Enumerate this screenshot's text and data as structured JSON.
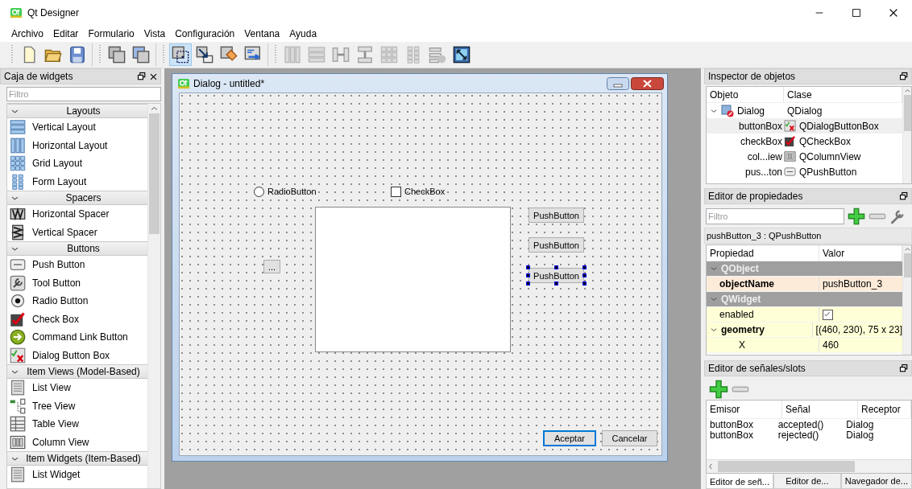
{
  "window": {
    "title": "Qt Designer"
  },
  "menu": [
    {
      "label": "Archivo"
    },
    {
      "label": "Editar"
    },
    {
      "label": "Formulario"
    },
    {
      "label": "Vista"
    },
    {
      "label": "Configuración"
    },
    {
      "label": "Ventana"
    },
    {
      "label": "Ayuda"
    }
  ],
  "toolbar": [
    [
      {
        "kind": "new",
        "selected": false,
        "disabled": false
      },
      {
        "kind": "open",
        "selected": false,
        "disabled": false
      },
      {
        "kind": "save",
        "selected": false,
        "disabled": false
      }
    ],
    [
      {
        "kind": "window_back",
        "selected": false,
        "disabled": false
      },
      {
        "kind": "window_front",
        "selected": false,
        "disabled": false
      }
    ],
    [
      {
        "kind": "edit_widgets",
        "selected": true,
        "disabled": false
      },
      {
        "kind": "signals",
        "selected": false,
        "disabled": false
      },
      {
        "kind": "buddies",
        "selected": false,
        "disabled": false
      },
      {
        "kind": "tab_order",
        "selected": false,
        "disabled": false
      }
    ],
    [
      {
        "kind": "hlayout",
        "selected": false,
        "disabled": true
      },
      {
        "kind": "vlayout",
        "selected": false,
        "disabled": true
      },
      {
        "kind": "hsplit",
        "selected": false,
        "disabled": true
      },
      {
        "kind": "vsplit",
        "selected": false,
        "disabled": true
      },
      {
        "kind": "grid",
        "selected": false,
        "disabled": true
      },
      {
        "kind": "form",
        "selected": false,
        "disabled": true
      },
      {
        "kind": "break_layout",
        "selected": false,
        "disabled": true
      },
      {
        "kind": "adjust_size",
        "selected": false,
        "disabled": false
      }
    ]
  ],
  "widget_box": {
    "title": "Caja de widgets",
    "filter": {
      "placeholder": "Filtro"
    },
    "categories": [
      {
        "label": "Layouts",
        "expanded": true,
        "items": [
          {
            "label": "Vertical Layout",
            "kind": "vlayout"
          },
          {
            "label": "Horizontal Layout",
            "kind": "hlayout"
          },
          {
            "label": "Grid Layout",
            "kind": "grid"
          },
          {
            "label": "Form Layout",
            "kind": "form"
          }
        ]
      },
      {
        "label": "Spacers",
        "expanded": true,
        "items": [
          {
            "label": "Horizontal Spacer",
            "kind": "hspacer"
          },
          {
            "label": "Vertical Spacer",
            "kind": "vspacer"
          }
        ]
      },
      {
        "label": "Buttons",
        "expanded": true,
        "items": [
          {
            "label": "Push Button",
            "kind": "pushbutton"
          },
          {
            "label": "Tool Button",
            "kind": "toolbutton"
          },
          {
            "label": "Radio Button",
            "kind": "radio"
          },
          {
            "label": "Check Box",
            "kind": "checkbox"
          },
          {
            "label": "Command Link Button",
            "kind": "commandlink"
          },
          {
            "label": "Dialog Button Box",
            "kind": "dialogbuttonbox"
          }
        ]
      },
      {
        "label": "Item Views (Model-Based)",
        "expanded": true,
        "items": [
          {
            "label": "List View",
            "kind": "listview"
          },
          {
            "label": "Tree View",
            "kind": "treeview"
          },
          {
            "label": "Table View",
            "kind": "tableview"
          },
          {
            "label": "Column View",
            "kind": "columnview"
          }
        ]
      },
      {
        "label": "Item Widgets (Item-Based)",
        "expanded": true,
        "items": [
          {
            "label": "List Widget",
            "kind": "listview"
          }
        ]
      }
    ]
  },
  "form": {
    "title": "Dialog - untitled*",
    "widgets": [
      {
        "kind": "radio",
        "label": "RadioButton",
        "checked": false,
        "selected": false
      },
      {
        "kind": "checkbox",
        "label": "CheckBox",
        "checked": false,
        "selected": false
      },
      {
        "kind": "columnview",
        "selected": false
      },
      {
        "kind": "pushbutton",
        "label": "PushButton",
        "selected": false
      },
      {
        "kind": "pushbutton",
        "label": "PushButton",
        "selected": false
      },
      {
        "kind": "pushbutton",
        "label": "PushButton",
        "selected": true
      },
      {
        "kind": "toolbutton",
        "label": "...",
        "selected": false
      },
      {
        "kind": "dialogbutton",
        "label": "Aceptar",
        "default": true,
        "selected": false
      },
      {
        "kind": "dialogbutton",
        "label": "Cancelar",
        "default": false,
        "selected": false
      }
    ]
  },
  "object_inspector": {
    "title": "Inspector de objetos",
    "columns": [
      "Objeto",
      "Clase"
    ],
    "tree": [
      {
        "object": "Dialog",
        "class": "QDialog",
        "kind": "dialog",
        "expanded": true,
        "selected": false,
        "children": [
          {
            "object": "buttonBox",
            "class": "QDialogButtonBox",
            "kind": "dialogbuttonbox",
            "selected": true
          },
          {
            "object": "checkBox",
            "class": "QCheckBox",
            "kind": "checkbox",
            "selected": false
          },
          {
            "object": "col...iew",
            "class": "QColumnView",
            "kind": "columnview",
            "selected": false
          },
          {
            "object": "pus...ton",
            "class": "QPushButton",
            "kind": "pushbutton",
            "selected": false
          }
        ]
      }
    ]
  },
  "property_editor": {
    "title": "Editor de propiedades",
    "filter": {
      "placeholder": "Filtro"
    },
    "subject": "pushButton_3 : QPushButton",
    "columns": [
      "Propiedad",
      "Valor"
    ],
    "groups": [
      {
        "name": "QObject",
        "expanded": true,
        "color": "#fdebd9",
        "properties": [
          {
            "kind": "text",
            "name": "objectName",
            "value": "pushButton_3",
            "changed": true
          }
        ]
      },
      {
        "name": "QWidget",
        "expanded": true,
        "color": "#ffffd7",
        "properties": [
          {
            "kind": "check",
            "name": "enabled",
            "checked": true,
            "changed": false
          },
          {
            "kind": "text",
            "name": "geometry",
            "value": "[(460, 230), 75 x 23]",
            "changed": true,
            "expanded": true,
            "children": [
              {
                "kind": "text",
                "name": "X",
                "value": "460",
                "changed": false
              }
            ]
          }
        ]
      }
    ]
  },
  "signal_slot_editor": {
    "title": "Editor de señales/slots",
    "columns": [
      "Emisor",
      "Señal",
      "Receptor"
    ],
    "rows": [
      {
        "sender": "buttonBox",
        "signal": "accepted()",
        "receiver": "Dialog"
      },
      {
        "sender": "buttonBox",
        "signal": "rejected()",
        "receiver": "Dialog"
      }
    ]
  },
  "bottom_tabs": [
    {
      "label": "Editor de señ...",
      "selected": true
    },
    {
      "label": "Editor de...",
      "selected": false
    },
    {
      "label": "Navegador de...",
      "selected": false
    }
  ]
}
